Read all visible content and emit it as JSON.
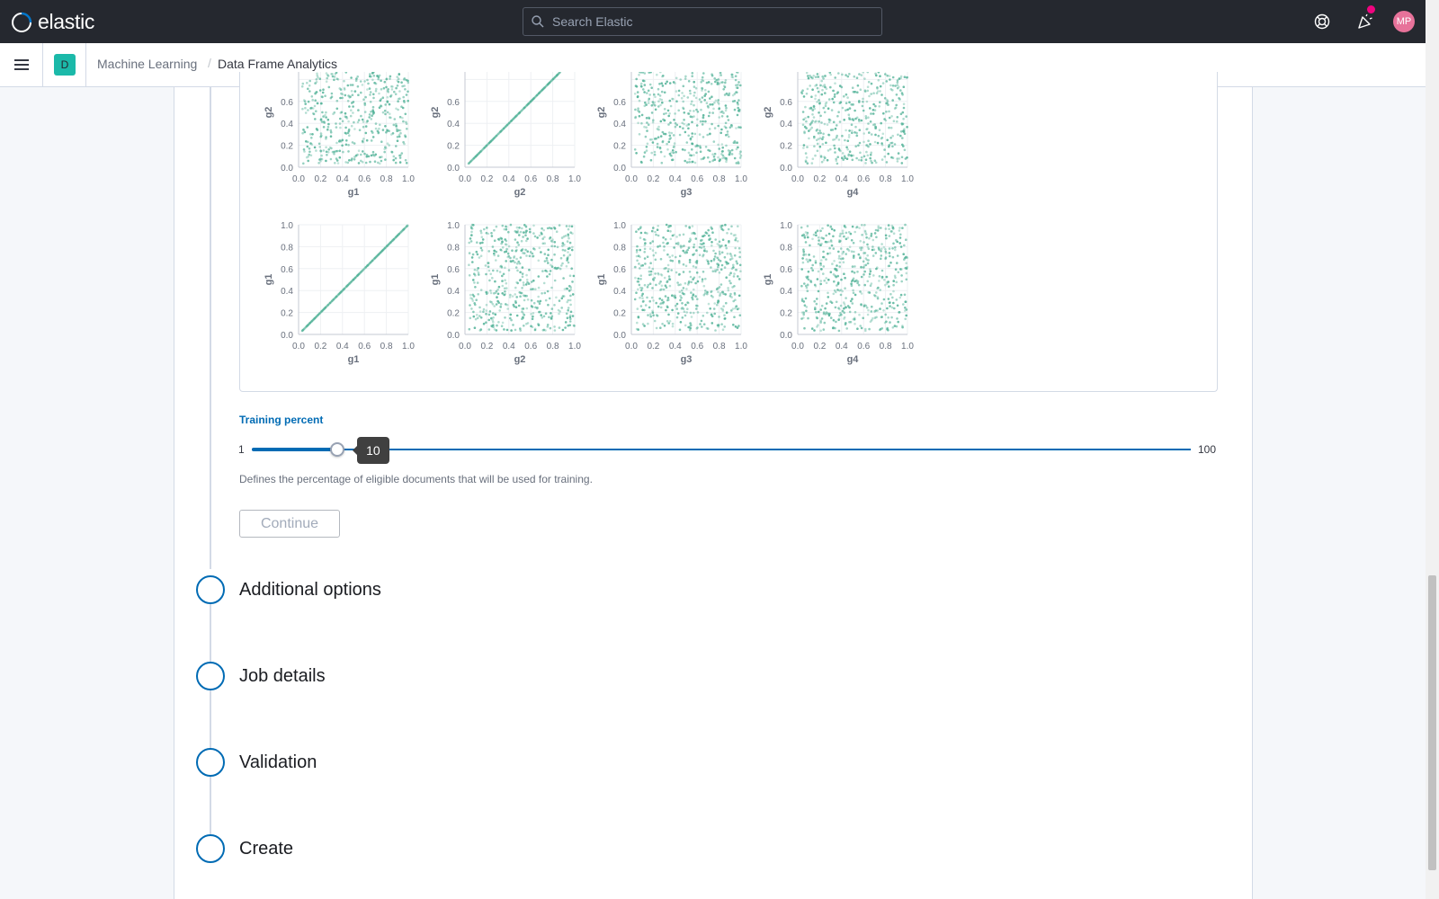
{
  "header": {
    "logo_text": "elastic",
    "search_placeholder": "Search Elastic",
    "avatar_initials": "MP",
    "icons": [
      "help-icon",
      "newsfeed-icon"
    ]
  },
  "breadcrumb": {
    "space_initial": "D",
    "items": [
      "Machine Learning",
      "Data Frame Analytics"
    ],
    "separator": "/"
  },
  "chart_data": {
    "type": "scatter",
    "title": "",
    "rows": [
      {
        "y_label": "g2",
        "y_ticks": [
          "0.0",
          "0.2",
          "0.4",
          "0.6"
        ]
      },
      {
        "y_label": "g1",
        "y_ticks": [
          "0.0",
          "0.2",
          "0.4",
          "0.6",
          "0.8",
          "1.0"
        ]
      }
    ],
    "columns": [
      "g1",
      "g2",
      "g3",
      "g4"
    ],
    "x_ticks": [
      "0.0",
      "0.2",
      "0.4",
      "0.6",
      "0.8",
      "1.0"
    ],
    "xlim": [
      0,
      1
    ],
    "ylim": [
      0,
      1
    ],
    "diagonal_panels": [
      [
        0,
        1
      ],
      [
        1,
        0
      ]
    ],
    "color": "#54b399"
  },
  "training": {
    "label": "Training percent",
    "min": "1",
    "max": "100",
    "value": "10",
    "help": "Defines the percentage of eligible documents that will be used for training.",
    "continue_label": "Continue"
  },
  "steps": [
    {
      "title": "Additional options"
    },
    {
      "title": "Job details"
    },
    {
      "title": "Validation"
    },
    {
      "title": "Create"
    }
  ]
}
